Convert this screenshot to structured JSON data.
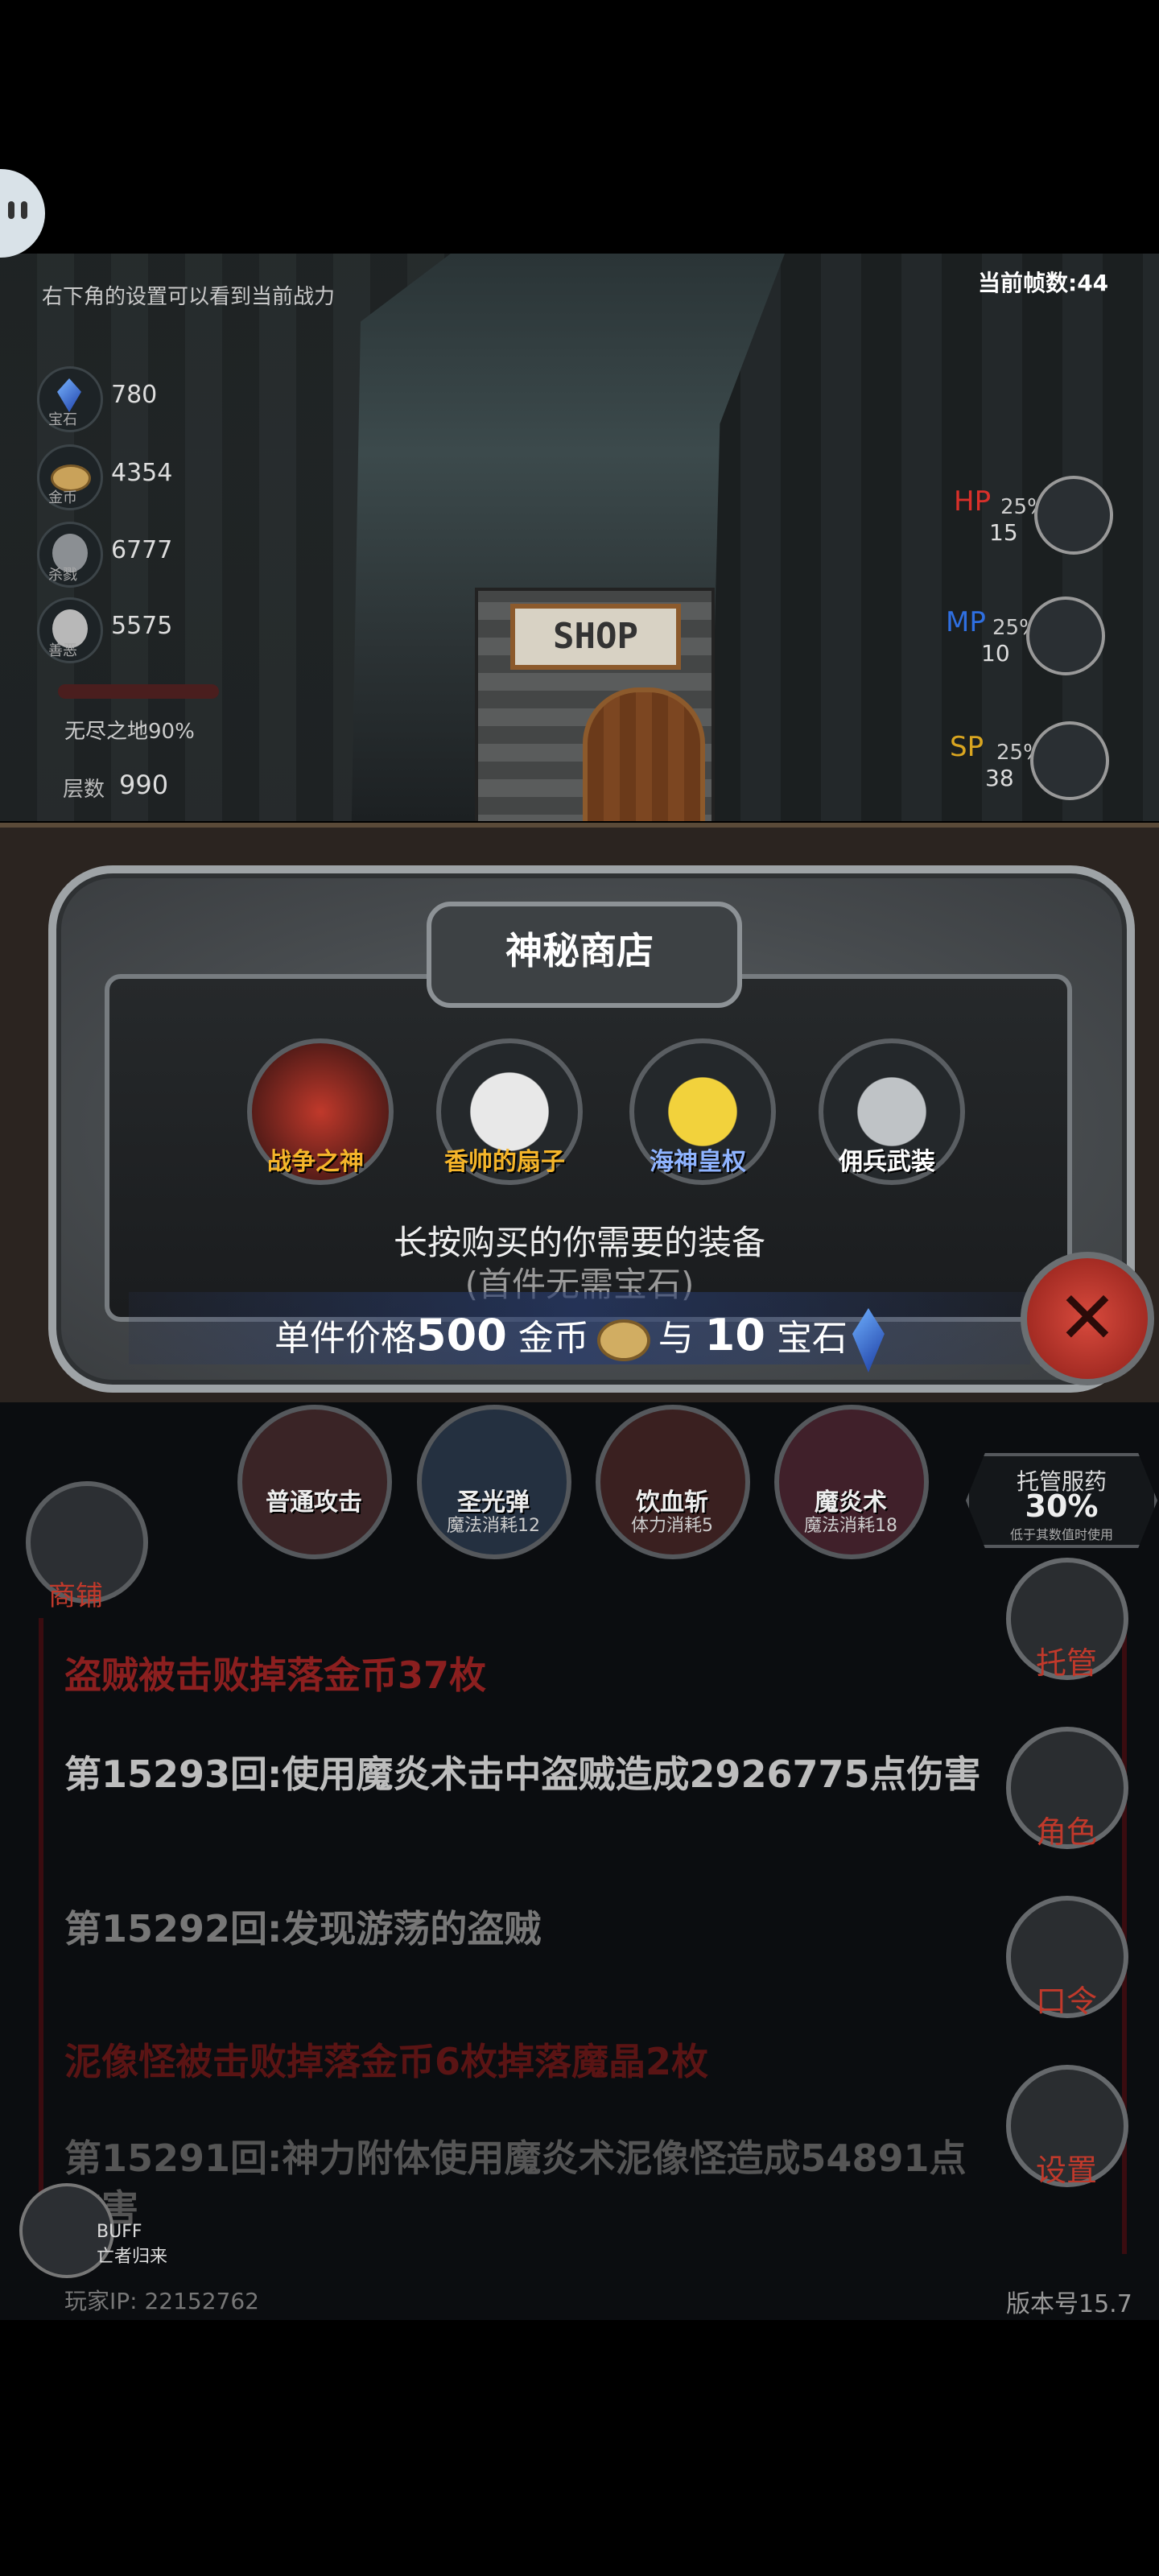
{
  "hud": {
    "tip": "右下角的设置可以看到当前战力",
    "fps": "当前帧数:44",
    "stats": [
      {
        "icon": "gem-icon",
        "icon_label": "宝石",
        "value": "780"
      },
      {
        "icon": "coin-icon",
        "icon_label": "金币",
        "value": "4354"
      },
      {
        "icon": "skull-icon",
        "icon_label": "杀戮",
        "value": "6777"
      },
      {
        "icon": "mask-icon",
        "icon_label": "善恶",
        "value": "5575"
      }
    ],
    "depth_label": "无尽之地90%",
    "layer_label": "层数",
    "layer_value": "990",
    "bars": [
      {
        "label": "HP",
        "pct": "25%",
        "value": "15",
        "color": "#d9302a"
      },
      {
        "label": "MP",
        "pct": "25%",
        "value": "10",
        "color": "#2f6fe0"
      },
      {
        "label": "SP",
        "pct": "25%",
        "value": "38",
        "color": "#d9a520"
      }
    ],
    "shop_sign": "SHOP"
  },
  "dialog": {
    "title": "神秘商店",
    "items": [
      {
        "name": "战争之神",
        "color": "#f5b52a"
      },
      {
        "name": "香帅的扇子",
        "color": "#f5b52a"
      },
      {
        "name": "海神皇权",
        "color": "#8fb4ff"
      },
      {
        "name": "佣兵武装",
        "color": "#ffffff"
      }
    ],
    "hint": "长按购买的你需要的装备",
    "hint_sub": "(首件无需宝石)",
    "price_prefix": "单件价格",
    "price_gold": "500",
    "price_gold_unit": "金币",
    "price_and": "与",
    "price_gem": "10",
    "price_gem_unit": "宝石"
  },
  "skills": [
    {
      "name": "普通攻击",
      "cost": ""
    },
    {
      "name": "圣光弹",
      "cost": "魔法消耗12"
    },
    {
      "name": "饮血斩",
      "cost": "体力消耗5"
    },
    {
      "name": "魔炎术",
      "cost": "魔法消耗18"
    }
  ],
  "auto": {
    "title": "托管服药",
    "percent": "30%",
    "sub": "低于其数值时使用"
  },
  "shop_button_label": "商铺",
  "side_buttons": [
    "托管",
    "角色",
    "口令",
    "设置"
  ],
  "log": [
    {
      "text": "盗贼被击败掉落金币37枚",
      "color": "#8b1f1f"
    },
    {
      "text": "第15293回:使用魔炎术击中盗贼造成2926775点伤害",
      "color": "#bdbdbd"
    },
    {
      "text": "第15292回:发现游荡的盗贼",
      "color": "#777777"
    },
    {
      "text": "泥像怪被击败掉落金币6枚掉落魔晶2枚",
      "color": "#5a1414"
    },
    {
      "text": "第15291回:神力附体使用魔炎术泥像怪造成54891点伤害",
      "color": "#555555"
    }
  ],
  "buff": {
    "label": "BUFF",
    "sub": "亡者归来"
  },
  "footer": {
    "ip": "玩家IP: 22152762",
    "version": "版本号15.7"
  }
}
